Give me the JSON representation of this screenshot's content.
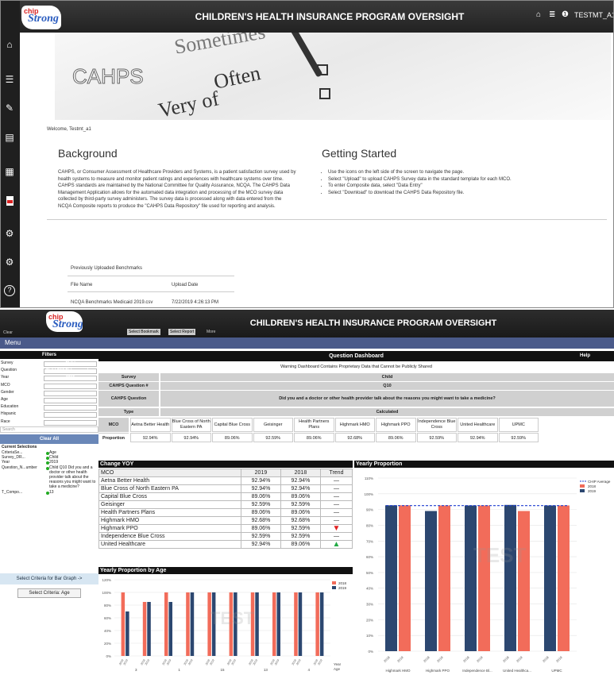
{
  "app": {
    "title": "CHILDREN'S HEALTH INSURANCE PROGRAM OVERSIGHT",
    "logo_top": "chip",
    "logo_bottom": "Strong",
    "user": "TESTMT_A1"
  },
  "colors": {
    "series2019": "#2c4770",
    "series2018": "#f26c5a",
    "chip_avg": "#1f3fd1"
  },
  "top": {
    "banner": {
      "word1": "CAHPS",
      "word2": "Often",
      "word3": "Very of",
      "word4": "Sometimes"
    },
    "welcome": "Welcome, Testmt_a1",
    "background_title": "Background",
    "background_text": "CAHPS, or Consumer Assessment of Healthcare Providers and Systems, is a patient satisfaction survey used by health systems to measure and monitor patient ratings and experiences with healthcare systems over time. CAHPS standards are maintained by the National Committee for Quality Assurance, NCQA. The CAHPS Data Management Application allows for the automated data integration and processing of the MCO survey data collected by third-party survey administers. The survey data is processed along with data entered from the NCQA Composite reports to produce the \"CAHPS Data Repository\" file used for reporting and analysis.",
    "getting_started_title": "Getting Started",
    "getting_started_items": [
      "Use the icons on the left side of the screen to navigate the page.",
      "Select \"Upload\" to upload CAHPS Survey data in the standard template for each MCO.",
      "To enter Composite data, select \"Data Entry\"",
      "Select \"Download\" to download the CAHPS Data Repository file."
    ],
    "uploaded_title": "Previously Uploaded Benchmarks",
    "file_name_header": "File Name",
    "upload_date_header": "Upload Date",
    "file_name": "NCQA Benchmarks Medicaid 2019.csv",
    "upload_date": "7/22/2019 4:26:13 PM",
    "sidebar_icons": [
      "home-icon",
      "list-icon",
      "edit-icon",
      "document-icon",
      "table-icon",
      "pdf-icon",
      "settings-icon",
      "settings-alt-icon",
      "help-icon"
    ]
  },
  "bottom": {
    "toolbar": {
      "clear": "Clear",
      "bookmark": "Select Bookmark",
      "report": "Select Report",
      "more": "More"
    },
    "menu": "Menu",
    "filters_title": "Filters",
    "dashboard_title": "Question Dashboard",
    "help": "Help",
    "warning": "Warning Dashboard Contains Proprietary Data that Cannot be Publicly Shared",
    "filters": [
      {
        "label": "Survey",
        "value": "Child"
      },
      {
        "label": "Question",
        "value": "Child Q10 Did you and a..."
      },
      {
        "label": "Year",
        "value": "2019"
      },
      {
        "label": "MCO",
        "value": ""
      },
      {
        "label": "Gender",
        "value": ""
      },
      {
        "label": "Age",
        "value": ""
      },
      {
        "label": "Education",
        "value": ""
      },
      {
        "label": "Hispanic",
        "value": ""
      },
      {
        "label": "Race",
        "value": ""
      }
    ],
    "search_placeholder": "Search",
    "clear_all": "Clear All",
    "current_selections": "Current Selections",
    "selections": [
      {
        "field": "CriteriaSe...",
        "values": "Age"
      },
      {
        "field": "Survey_DR...",
        "values": "Child"
      },
      {
        "field": "Year",
        "values": "2019"
      },
      {
        "field": "Question_N...umber",
        "values": "Child Q10 Did you and a doctor or other health provider talk about the reasons you might want to take a medicine?"
      },
      {
        "field": "T_Compo...",
        "values": "13"
      }
    ],
    "select_criteria": "Select Criteria for Bar Graph ->",
    "select_criteria_value": "Select Criteria: Age",
    "info_rows": [
      {
        "label": "Survey",
        "value": "Child"
      },
      {
        "label": "CAHPS Question #",
        "value": "Q10"
      },
      {
        "label": "CAHPS Question",
        "value": "Did you and a doctor or other health provider talk about the reasons you might want to take a medicine?"
      },
      {
        "label": "Type",
        "value": "Calculated"
      }
    ],
    "mco_header": "MCO",
    "proportion_label": "Proportion",
    "mcos": [
      "Aetna Better Health",
      "Blue Cross of North Eastern PA",
      "Capital Blue Cross",
      "Geisinger",
      "Health Partners Plans",
      "Highmark HMO",
      "Highmark PPO",
      "Independence Blue Cross",
      "United Healthcare",
      "UPMC"
    ],
    "proportions": [
      "92.94%",
      "92.94%",
      "89.06%",
      "92.59%",
      "89.06%",
      "92.68%",
      "89.06%",
      "92.59%",
      "92.94%",
      "92.59%"
    ],
    "change_yoy": {
      "title": "Change YOY",
      "headers": [
        "MCO",
        "2019",
        "2018",
        "Trend"
      ],
      "rows": [
        [
          "Aetna Better Health",
          "92.94%",
          "92.94%",
          "—"
        ],
        [
          "Blue Cross of North Eastern PA",
          "92.94%",
          "92.94%",
          "—"
        ],
        [
          "Capital Blue Cross",
          "89.06%",
          "89.06%",
          "—"
        ],
        [
          "Geisinger",
          "92.59%",
          "92.59%",
          "—"
        ],
        [
          "Health Partners Plans",
          "89.06%",
          "89.06%",
          "—"
        ],
        [
          "Highmark HMO",
          "92.68%",
          "92.68%",
          "—"
        ],
        [
          "Highmark PPO",
          "89.06%",
          "92.59%",
          "▼"
        ],
        [
          "Independence Blue Cross",
          "92.59%",
          "92.59%",
          "—"
        ],
        [
          "United Healthcare",
          "92.94%",
          "89.06%",
          "▲"
        ]
      ]
    },
    "watermark": "TEST"
  },
  "chart_data": [
    {
      "type": "bar",
      "title": "Yearly Proportion",
      "categories": [
        "Highmark HMO",
        "Highmark PPO",
        "Independence Bl...",
        "United Healthca...",
        "UPMC"
      ],
      "series": [
        {
          "name": "2019",
          "values": [
            92.68,
            89.06,
            92.59,
            92.94,
            92.59
          ]
        },
        {
          "name": "2018",
          "values": [
            92.68,
            92.59,
            92.59,
            89.06,
            92.59
          ]
        }
      ],
      "reference_line": {
        "name": "CHIP Average",
        "value": 92.5
      },
      "x_tick_years": [
        "2018",
        "2019"
      ],
      "ylim": [
        0,
        110
      ],
      "yticks": [
        "0%",
        "10%",
        "20%",
        "30%",
        "40%",
        "50%",
        "60%",
        "70%",
        "80%",
        "90%",
        "100%",
        "110%"
      ],
      "legend": "top-right",
      "grid": true
    },
    {
      "type": "bar",
      "title": "Yearly Proportion by Age",
      "categories": [
        "3",
        "",
        "1",
        "",
        "15",
        "",
        "13",
        "",
        "4",
        ""
      ],
      "series": [
        {
          "name": "2019",
          "values": [
            100,
            85,
            100,
            100,
            100,
            100,
            100,
            100,
            100,
            100
          ]
        },
        {
          "name": "2018",
          "values": [
            70,
            85,
            85,
            100,
            100,
            100,
            100,
            100,
            100,
            100
          ]
        }
      ],
      "x_tick_years": [
        "2018",
        "2019"
      ],
      "xlabel": "Year\nAge",
      "ylim": [
        0,
        120
      ],
      "yticks": [
        "0%",
        "20%",
        "40%",
        "60%",
        "80%",
        "100%",
        "120%"
      ],
      "legend": "top-right",
      "grid": true
    }
  ]
}
